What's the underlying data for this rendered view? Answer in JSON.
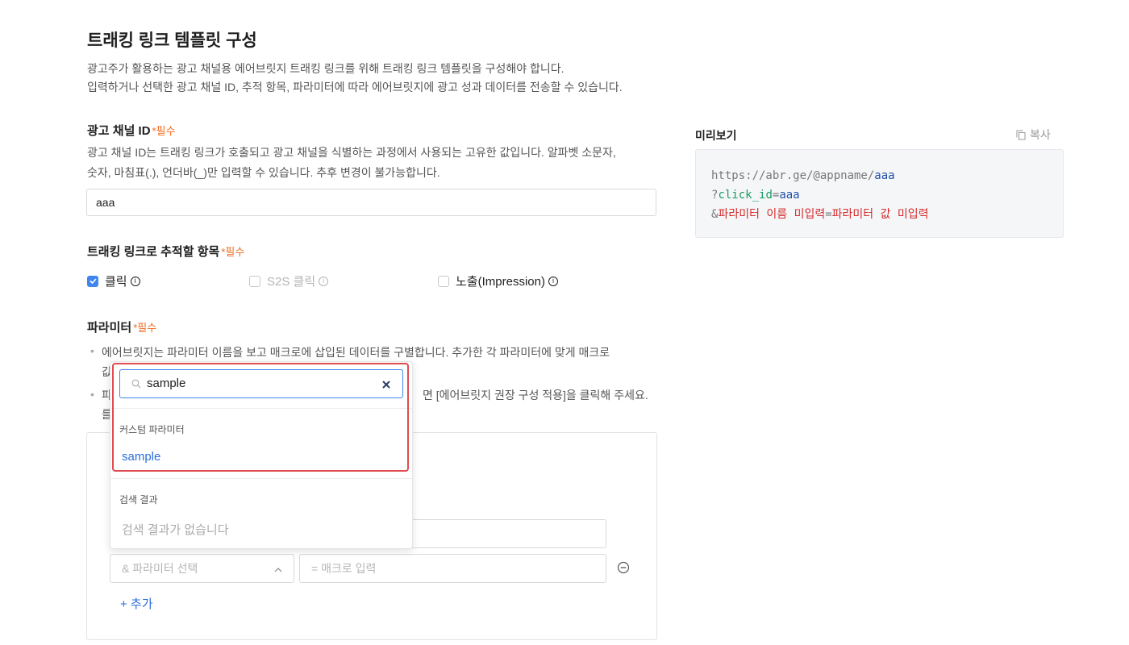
{
  "header": {
    "title": "트래킹 링크 템플릿 구성",
    "desc_line1": "광고주가 활용하는 광고 채널용 에어브릿지 트래킹 링크를 위해 트래킹 링크 템플릿을 구성해야 합니다.",
    "desc_line2": "입력하거나 선택한 광고 채널 ID, 추적 항목, 파라미터에 따라 에어브릿지에 광고 성과 데이터를 전송할 수 있습니다."
  },
  "required_label": "*필수",
  "channel_id": {
    "label": "광고 채널 ID",
    "desc_line1": "광고 채널 ID는 트래킹 링크가 호출되고 광고 채널을 식별하는 과정에서 사용되는 고유한 값입니다. 알파벳 소문자,",
    "desc_line2": "숫자, 마침표(.), 언더바(_)만 입력할 수 있습니다. 추후 변경이 불가능합니다.",
    "value": "aaa"
  },
  "tracking": {
    "label": "트래킹 링크로 추적할 항목",
    "options": [
      {
        "label": "클릭",
        "checked": true,
        "enabled": true
      },
      {
        "label": "S2S 클릭",
        "checked": false,
        "enabled": false
      },
      {
        "label": "노출(Impression)",
        "checked": false,
        "enabled": true
      }
    ]
  },
  "parameters": {
    "label": "파라미터",
    "bullet1_line1": "에어브릿지는 파라미터 이름을 보고 매크로에 삽입된 데이터를 구별합니다. 추가한 각 파라미터에 맞게 매크로",
    "bullet1_line2_start": "값",
    "bullet2_line1_start": "파",
    "bullet2_line1_end": "면 [에어브릿지 권장 구성 적용]을 클릭해 주세요.",
    "bullet2_line2_start": "를",
    "row_param_placeholder": "& 파라미터 선택",
    "row_macro_placeholder": "= 매크로 입력",
    "add_label": "+ 추가"
  },
  "dropdown": {
    "search_value": "sample",
    "custom_header": "커스텀 파라미터",
    "custom_item": "sample",
    "result_header": "검색 결과",
    "result_empty": "검색 결과가 없습니다"
  },
  "preview": {
    "title": "미리보기",
    "copy_label": "복사",
    "line1_base": "https://abr.ge/@appname/",
    "line1_value": "aaa",
    "line2_q": "?",
    "line2_key": "click_id",
    "line2_eq": "=",
    "line2_value": "aaa",
    "line3_amp": "&",
    "line3_key": "파라미터 이름 미입력",
    "line3_eq": "=",
    "line3_value": "파라미터 값 미입력"
  },
  "colors": {
    "accent": "#3f86f0",
    "required": "#f06a1e",
    "highlight": "#e04b4f",
    "preview_key": "#1a9a61",
    "preview_value": "#1f4fa8",
    "preview_missing": "#d42d2d"
  }
}
